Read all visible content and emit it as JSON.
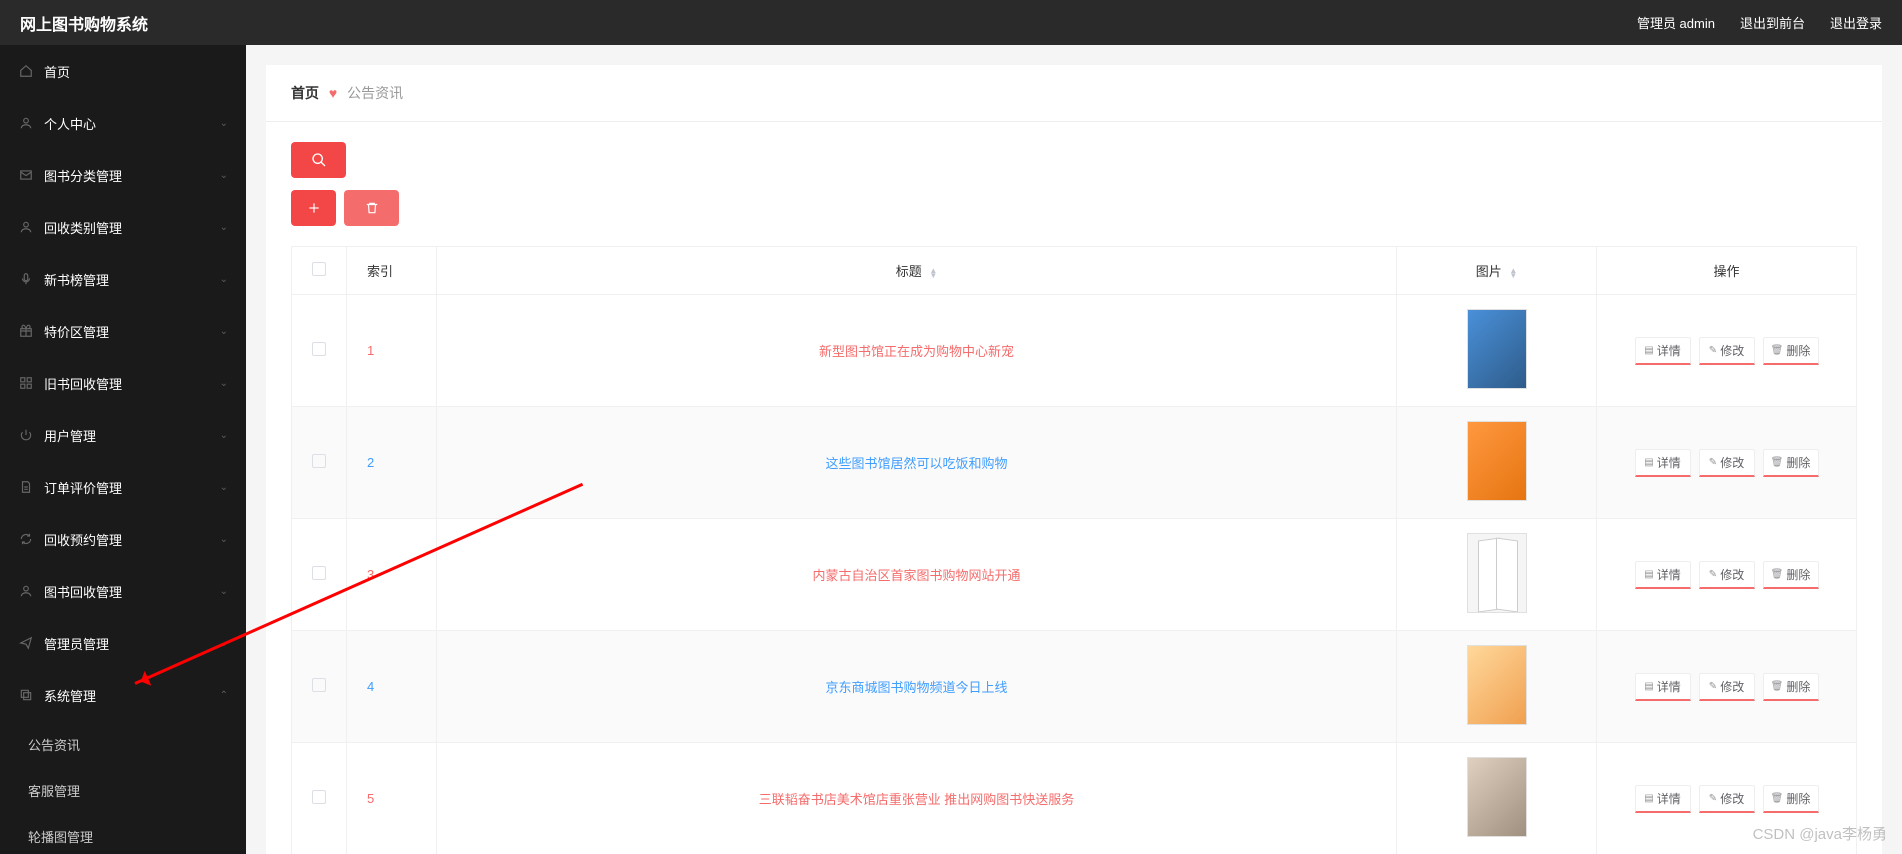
{
  "header": {
    "logo": "网上图书购物系统",
    "admin_label": "管理员 admin",
    "exit_front": "退出到前台",
    "logout": "退出登录"
  },
  "sidebar": {
    "items": [
      {
        "icon": "home-icon",
        "label": "首页",
        "expandable": false
      },
      {
        "icon": "user-icon",
        "label": "个人中心",
        "expandable": true
      },
      {
        "icon": "mail-icon",
        "label": "图书分类管理",
        "expandable": true
      },
      {
        "icon": "user-icon",
        "label": "回收类别管理",
        "expandable": true
      },
      {
        "icon": "mic-icon",
        "label": "新书榜管理",
        "expandable": true
      },
      {
        "icon": "gift-icon",
        "label": "特价区管理",
        "expandable": true
      },
      {
        "icon": "grid-icon",
        "label": "旧书回收管理",
        "expandable": true
      },
      {
        "icon": "power-icon",
        "label": "用户管理",
        "expandable": true
      },
      {
        "icon": "file-icon",
        "label": "订单评价管理",
        "expandable": true
      },
      {
        "icon": "refresh-icon",
        "label": "回收预约管理",
        "expandable": true
      },
      {
        "icon": "user-icon",
        "label": "图书回收管理",
        "expandable": true
      },
      {
        "icon": "send-icon",
        "label": "管理员管理",
        "expandable": true
      },
      {
        "icon": "copy-icon",
        "label": "系统管理",
        "expandable": true,
        "expanded": true,
        "children": [
          {
            "label": "公告资讯"
          },
          {
            "label": "客服管理"
          },
          {
            "label": "轮播图管理"
          }
        ]
      }
    ]
  },
  "breadcrumb": {
    "home": "首页",
    "current": "公告资讯"
  },
  "table": {
    "headers": {
      "index": "索引",
      "title": "标题",
      "image": "图片",
      "action": "操作"
    },
    "actions": {
      "detail": "详情",
      "edit": "修改",
      "delete": "删除"
    },
    "rows": [
      {
        "index": "1",
        "title": "新型图书馆正在成为购物中心新宠",
        "color": "red",
        "img": "bi1"
      },
      {
        "index": "2",
        "title": "这些图书馆居然可以吃饭和购物",
        "color": "blue",
        "img": "bi2"
      },
      {
        "index": "3",
        "title": "内蒙古自治区首家图书购物网站开通",
        "color": "red",
        "img": "bi3"
      },
      {
        "index": "4",
        "title": "京东商城图书购物频道今日上线",
        "color": "blue",
        "img": "bi4"
      },
      {
        "index": "5",
        "title": "三联韬奋书店美术馆店重张营业 推出网购图书快送服务",
        "color": "red",
        "img": "bi5"
      }
    ]
  },
  "watermark": "CSDN @java李杨勇"
}
